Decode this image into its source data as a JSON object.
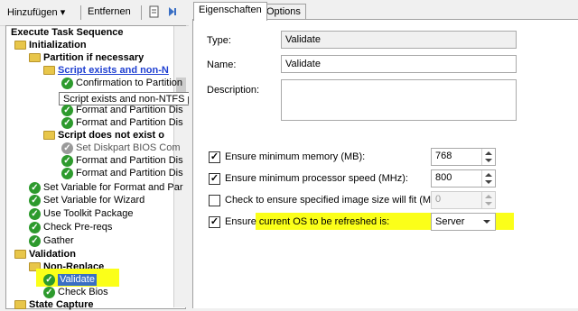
{
  "toolbar": {
    "add_label": "Hinzufügen ▾",
    "remove_label": "Entfernen"
  },
  "tree": {
    "root": "Execute Task Sequence",
    "initialization": "Initialization",
    "partition": "Partition if necessary",
    "script_exists": "Script exists and non-N",
    "confirm": "Confirmation to Partition",
    "format1": "Format and Partition Dis",
    "format2": "Format and Partition Dis",
    "script_not_exist": "Script does not exist o",
    "set_bios": "Set Diskpart BIOS Com",
    "format3": "Format and Partition Dis",
    "format4": "Format and Partition Dis",
    "setvar_format": "Set Variable for Format and Par",
    "setvar_wizard": "Set Variable for Wizard",
    "use_toolkit": "Use Toolkit Package",
    "check_prereqs": "Check Pre-reqs",
    "gather": "Gather",
    "validation": "Validation",
    "non_replace": "Non-Replace",
    "validate": "Validate",
    "check_bios": "Check Bios",
    "state_capture": "State Capture",
    "tooltip": "Script exists and non-NTFS partitions"
  },
  "tabs": {
    "properties": "Eigenschaften",
    "options": "Options"
  },
  "props": {
    "type_label": "Type:",
    "type_value": "Validate",
    "name_label": "Name:",
    "name_value": "Validate",
    "desc_label": "Description:"
  },
  "checks": {
    "memory_label": "Ensure minimum memory (MB):",
    "memory_value": "768",
    "memory_checked": true,
    "cpu_label": "Ensure minimum processor speed (MHz):",
    "cpu_value": "800",
    "cpu_checked": true,
    "image_label": "Check to ensure specified image size will fit (MB):",
    "image_value": "0",
    "image_checked": false,
    "os_label": "Ensure current OS to be refreshed is:",
    "os_value": "Server",
    "os_checked": true
  },
  "colors": {
    "highlight": "#fbff19",
    "ok_green": "#2d9a2d",
    "link_blue": "#1f3fd1"
  }
}
